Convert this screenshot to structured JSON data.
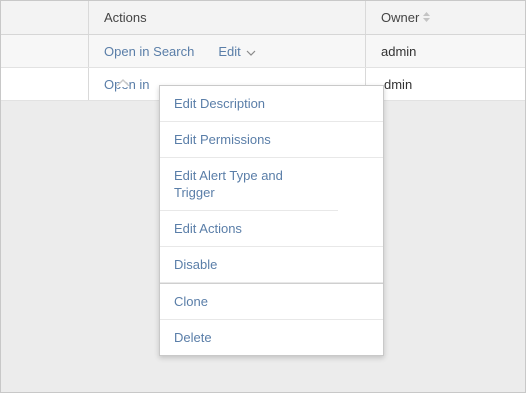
{
  "table": {
    "headers": {
      "actions": "Actions",
      "owner": "Owner",
      "owner_sort_icon": "sort-icon"
    },
    "rows": [
      {
        "open_link": "Open in Search",
        "edit_label": "Edit",
        "owner": "admin"
      },
      {
        "open_link": "Open in",
        "owner": "dmin"
      }
    ]
  },
  "edit_menu": {
    "items": [
      "Edit Description",
      "Edit Permissions",
      "Edit Alert Type and Trigger",
      "Edit Actions",
      "Disable",
      "Clone",
      "Delete"
    ]
  },
  "colors": {
    "link": "#5a7ea8",
    "background": "#ececec",
    "header_bg": "#f3f3f3"
  }
}
